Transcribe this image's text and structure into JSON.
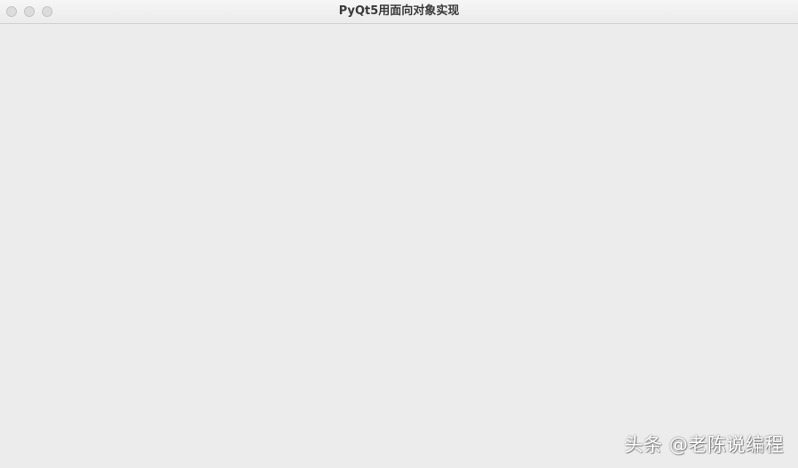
{
  "window": {
    "title": "PyQt5用面向对象实现"
  },
  "watermark": {
    "text": "头条 @老陈说编程"
  },
  "colors": {
    "titlebar": "#f0f0f0",
    "content_bg": "#ececec",
    "traffic_light": "#dcdcdc"
  }
}
